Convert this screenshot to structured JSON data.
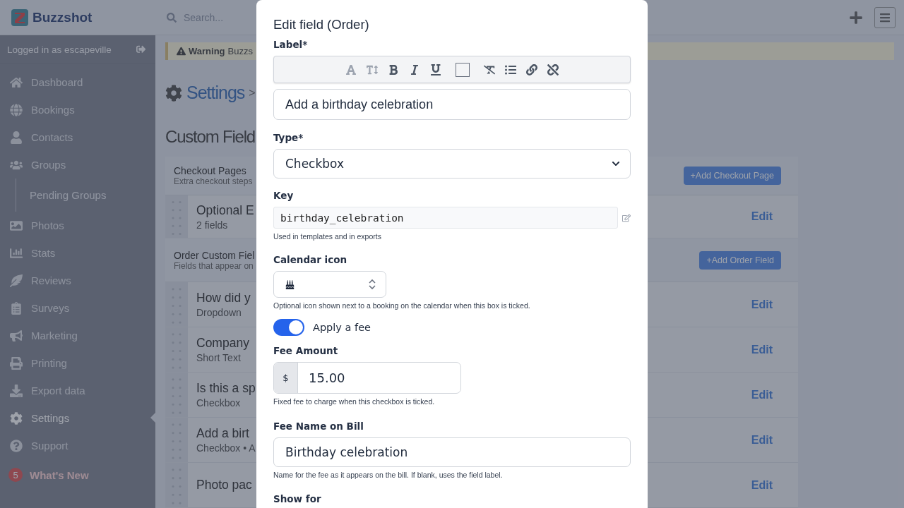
{
  "topbar": {
    "brand": "Buzzshot",
    "search": {
      "placeholder": "Search..."
    }
  },
  "sidebar": {
    "user": "Logged in as escapeville",
    "items": [
      {
        "label": "Dashboard",
        "kind": "item",
        "selected": false
      },
      {
        "label": "Bookings",
        "kind": "item",
        "selected": false
      },
      {
        "label": "Contacts",
        "kind": "item",
        "selected": false
      },
      {
        "label": "Groups",
        "kind": "item",
        "selected": false
      },
      {
        "label": "Pending Groups",
        "kind": "subitem",
        "selected": false
      },
      {
        "label": "Photos",
        "kind": "item",
        "selected": false
      },
      {
        "label": "Stats",
        "kind": "item",
        "selected": false
      },
      {
        "label": "Reviews",
        "kind": "item",
        "selected": false
      },
      {
        "label": "Surveys",
        "kind": "item",
        "selected": false
      },
      {
        "label": "Marketing",
        "kind": "item",
        "selected": false
      },
      {
        "label": "Printing",
        "kind": "item",
        "selected": false
      },
      {
        "label": "Export data",
        "kind": "item",
        "selected": false
      },
      {
        "label": "Settings",
        "kind": "item",
        "selected": true
      },
      {
        "label": "Support",
        "kind": "item",
        "selected": false
      }
    ],
    "whats_new": {
      "badge": "5",
      "label": "What's New"
    }
  },
  "main": {
    "warning": {
      "title": "Warning",
      "text": "Buzzs"
    },
    "breadcrumb": {
      "link": "Settings",
      "separator": ">"
    },
    "heading": "Custom Field",
    "sections": [
      {
        "title": "Checkout Pages",
        "subtitle": "Extra checkout steps",
        "button": "+Add Checkout Page",
        "rows": [
          {
            "title": "Optional E",
            "subtitle": "2 fields",
            "action": "Edit"
          }
        ]
      },
      {
        "title": "Order Custom Fiel",
        "subtitle": "Fields that appear on",
        "button": "+Add Order Field",
        "rows": [
          {
            "title": "How did y",
            "subtitle": "Dropdown",
            "action": "Edit"
          },
          {
            "title": "Company",
            "subtitle": "Short Text",
            "action": "Edit"
          },
          {
            "title": "Is this a sp",
            "subtitle": "Checkbox",
            "action": "Edit"
          },
          {
            "title": "Add a birt",
            "subtitle": "Checkbox • A",
            "action": "Edit"
          },
          {
            "title": "Photo pac",
            "action": "Edit"
          }
        ]
      }
    ]
  },
  "modal": {
    "title": "Edit field (Order)",
    "label_field": {
      "label": "Label*",
      "value": "Add a birthday celebration"
    },
    "type_field": {
      "label": "Type*",
      "value": "Checkbox"
    },
    "key_field": {
      "label": "Key",
      "value": "birthday_celebration",
      "help": "Used in templates and in exports"
    },
    "calendar_icon": {
      "label": "Calendar icon",
      "help": "Optional icon shown next to a booking on the calendar when this box is ticked."
    },
    "fee_toggle": {
      "label": "Apply a fee",
      "on": true
    },
    "fee_amount": {
      "label": "Fee Amount",
      "prefix": "$",
      "value": "15.00",
      "help": "Fixed fee to charge when this checkbox is ticked."
    },
    "fee_name": {
      "label": "Fee Name on Bill",
      "value": "Birthday celebration",
      "help": "Name for the fee as it appears on the bill. If blank, uses the field label."
    },
    "show_for": {
      "label": "Show for"
    }
  }
}
